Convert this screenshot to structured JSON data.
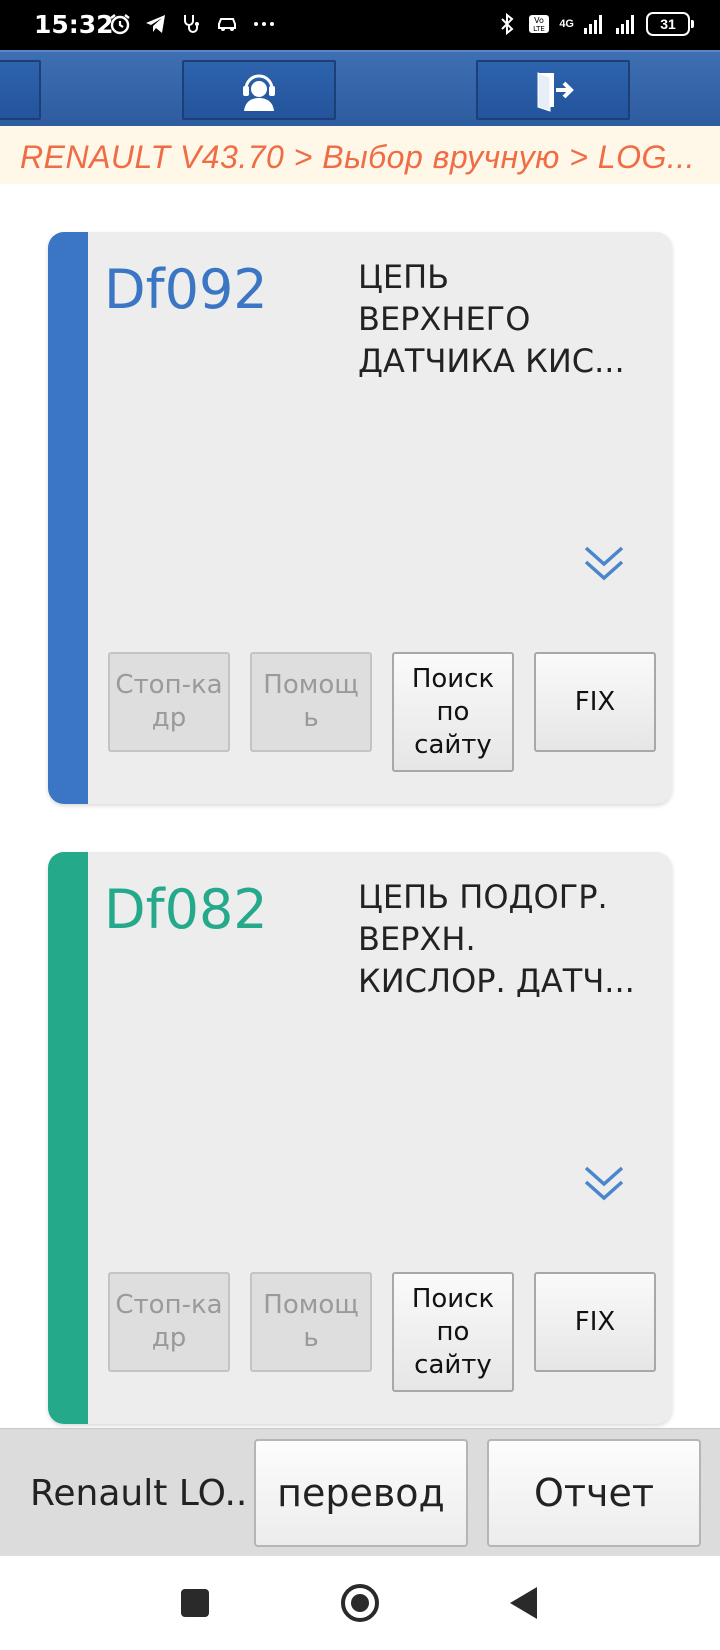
{
  "status_bar": {
    "time": "15:32",
    "network": "4G",
    "battery": "31",
    "icons": [
      "alarm-icon",
      "telegram-icon",
      "stethoscope-icon",
      "car-icon",
      "more-dots-icon",
      "bluetooth-icon",
      "volte-icon",
      "signal-icon",
      "signal-icon",
      "battery-icon"
    ]
  },
  "toolbar": {
    "buttons": [
      "menu-partial-button",
      "support-button",
      "exit-button"
    ]
  },
  "breadcrumb": {
    "text": "RENAULT V43.70 > Выбор вручную > LOG..."
  },
  "faults": [
    {
      "code": "Df092",
      "description": "ЦЕПЬ\nВЕРХНЕГО\nДАТЧИКА КИС...",
      "color": "#3a76c4",
      "buttons": {
        "freeze_frame": "Стоп-ка\nдр",
        "help": "Помощ\nь",
        "web_search": "Поиск\nпо\nсайту",
        "fix": "FIX"
      }
    },
    {
      "code": "Df082",
      "description": "ЦЕПЬ ПОДОГР.\nВЕРХН.\nКИСЛОР. ДАТЧ...",
      "color": "#25a98b",
      "buttons": {
        "freeze_frame": "Стоп-ка\nдр",
        "help": "Помощ\nь",
        "web_search": "Поиск\nпо\nсайту",
        "fix": "FIX"
      }
    }
  ],
  "bottom_bar": {
    "vehicle": "Renault LO..",
    "translate": "перевод",
    "report": "Отчет"
  },
  "colors": {
    "toolbar": "#2f5fa5",
    "breadcrumb_text": "#ef6c45",
    "breadcrumb_bg": "#fff7e7",
    "expand_icon": "#4a86cc"
  }
}
